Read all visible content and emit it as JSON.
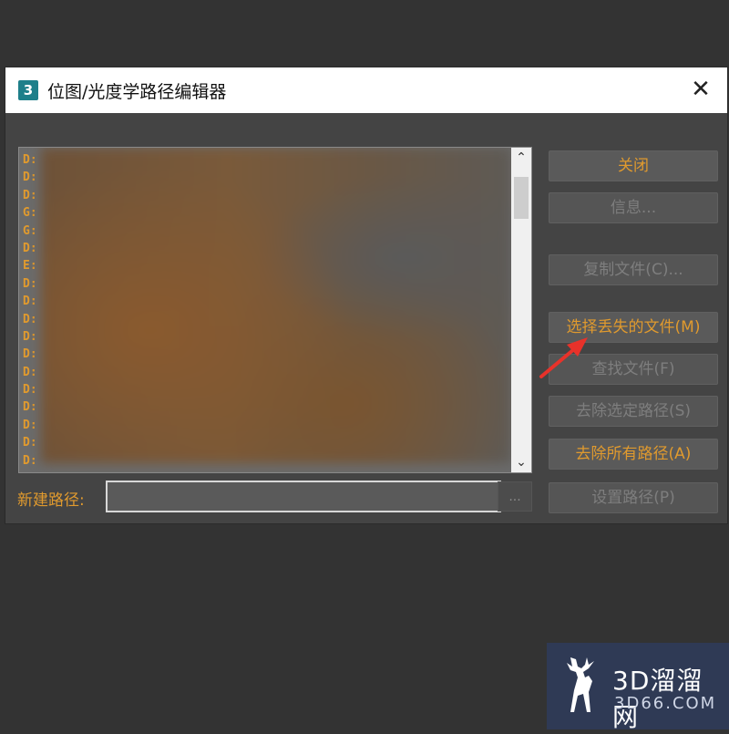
{
  "window": {
    "app_icon_glyph": "3",
    "title": "位图/光度学路径编辑器",
    "close_glyph": "✕"
  },
  "file_list": {
    "line_prefixes": [
      "D:",
      "D:",
      "D:",
      "G:",
      "G:",
      "D:",
      "E:",
      "D:",
      "D:",
      "D:",
      "D:",
      "D:",
      "D:",
      "D:",
      "D:",
      "D:",
      "D:",
      "D:"
    ],
    "scroll_up_glyph": "⌃",
    "scroll_down_glyph": "⌄"
  },
  "new_path": {
    "label": "新建路径:",
    "value": "",
    "browse_label": "..."
  },
  "buttons": {
    "close": "关闭",
    "info": "信息...",
    "copy_files": "复制文件(C)...",
    "select_missing": "选择丢失的文件(M)",
    "find_files": "查找文件(F)",
    "strip_selected": "去除选定路径(S)",
    "strip_all": "去除所有路径(A)",
    "set_path": "设置路径(P)"
  },
  "colors": {
    "accent": "#e09a2e",
    "dialog_bg": "#444444",
    "annotation_arrow": "#e8322a"
  },
  "watermark": {
    "name": "3D溜溜网",
    "domain": "3D66.COM"
  }
}
